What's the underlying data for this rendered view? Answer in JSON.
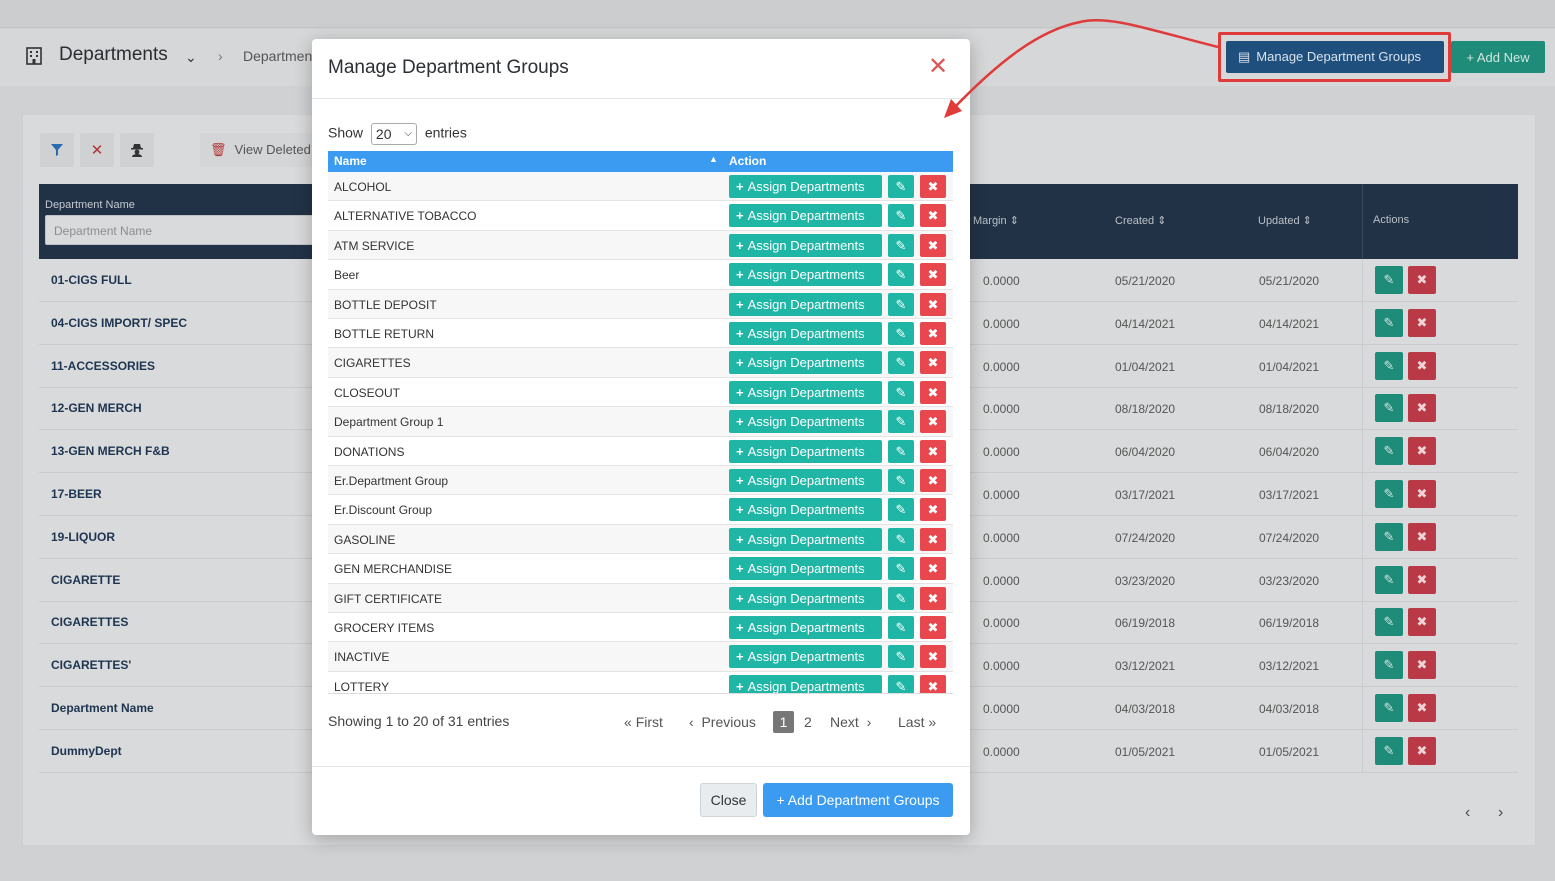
{
  "header": {
    "title": "Departments",
    "breadcrumb": "Departmen",
    "manage_groups_label": "Manage Department Groups",
    "add_new_label": "Add New"
  },
  "filters": {
    "view_deleted_label": "View Deleted Items"
  },
  "table": {
    "dept_name_header": "Department Name",
    "dept_name_placeholder": "Department Name",
    "col_margin": "Margin",
    "col_created": "Created",
    "col_updated": "Updated",
    "col_actions": "Actions",
    "rows": [
      {
        "name": "01-CIGS FULL",
        "margin": "0.0000",
        "created": "05/21/2020",
        "updated": "05/21/2020"
      },
      {
        "name": "04-CIGS IMPORT/ SPEC",
        "margin": "0.0000",
        "created": "04/14/2021",
        "updated": "04/14/2021"
      },
      {
        "name": "11-ACCESSORIES",
        "margin": "0.0000",
        "created": "01/04/2021",
        "updated": "01/04/2021"
      },
      {
        "name": "12-GEN MERCH",
        "margin": "0.0000",
        "created": "08/18/2020",
        "updated": "08/18/2020"
      },
      {
        "name": "13-GEN MERCH F&B",
        "margin": "0.0000",
        "created": "06/04/2020",
        "updated": "06/04/2020"
      },
      {
        "name": "17-BEER",
        "margin": "0.0000",
        "created": "03/17/2021",
        "updated": "03/17/2021"
      },
      {
        "name": "19-LIQUOR",
        "margin": "0.0000",
        "created": "07/24/2020",
        "updated": "07/24/2020"
      },
      {
        "name": "CIGARETTE",
        "margin": "0.0000",
        "created": "03/23/2020",
        "updated": "03/23/2020"
      },
      {
        "name": "CIGARETTES",
        "margin": "0.0000",
        "created": "06/19/2018",
        "updated": "06/19/2018"
      },
      {
        "name": "CIGARETTES'",
        "margin": "0.0000",
        "created": "03/12/2021",
        "updated": "03/12/2021"
      },
      {
        "name": "Department Name",
        "margin": "0.0000",
        "created": "04/03/2018",
        "updated": "04/03/2018"
      },
      {
        "name": "DummyDept",
        "margin": "0.0000",
        "created": "01/05/2021",
        "updated": "01/05/2021"
      }
    ]
  },
  "modal": {
    "title": "Manage Department Groups",
    "show_label": "Show",
    "show_value": "20",
    "entries_label": "entries",
    "col_name": "Name",
    "col_action": "Action",
    "assign_label": "Assign Departments",
    "groups": [
      "ALCOHOL",
      "ALTERNATIVE TOBACCO",
      "ATM SERVICE",
      "Beer",
      "BOTTLE DEPOSIT",
      "BOTTLE RETURN",
      "CIGARETTES",
      "CLOSEOUT",
      "Department Group 1",
      "DONATIONS",
      "Er.Department Group",
      "Er.Discount Group",
      "GASOLINE",
      "GEN MERCHANDISE",
      "GIFT CERTIFICATE",
      "GROCERY ITEMS",
      "INACTIVE",
      "LOTTERY"
    ],
    "info": "Showing 1 to 20 of 31 entries",
    "pager": {
      "first": "First",
      "previous": "Previous",
      "current": "1",
      "page2": "2",
      "next": "Next",
      "last": "Last"
    },
    "close_label": "Close",
    "add_label": "Add Department Groups"
  },
  "colors": {
    "accent_blue": "#3a9bf0",
    "teal": "#20b6a6",
    "danger": "#e8474e",
    "annotation_red": "#e03b3b"
  },
  "icons": [
    "building-icon",
    "chevron-down-icon",
    "list-icon",
    "plus-icon",
    "filter-icon",
    "close-icon",
    "user-secret-icon",
    "trash-icon",
    "sort-icon",
    "pencil-icon",
    "times-icon",
    "chevron-left-icon",
    "chevron-right-icon",
    "double-chevron-left-icon",
    "double-chevron-right-icon"
  ]
}
